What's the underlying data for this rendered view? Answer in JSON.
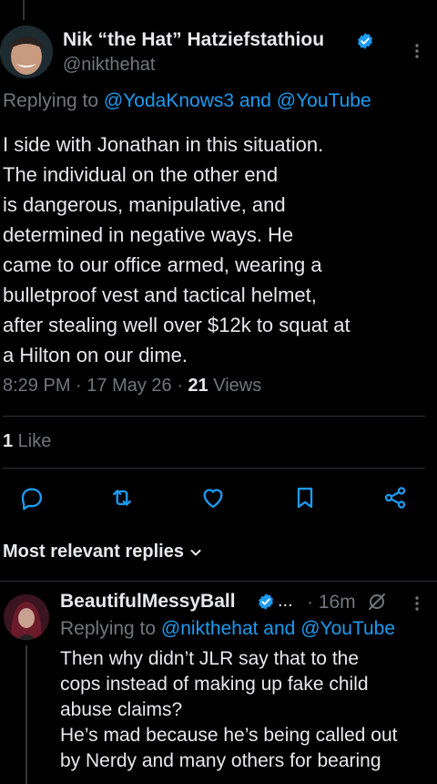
{
  "tweet": {
    "author_name": "Nik “the Hat” Hatziefstathiou",
    "handle": "@nikthehat",
    "replying_prefix": "Replying to ",
    "replying_to_1": "@YodaKnows3",
    "replying_and": " and ",
    "replying_to_2": "@YouTube",
    "text": "I side with Jonathan in this situation.\nThe individual on the other end\nis dangerous, manipulative, and\ndetermined in negative ways. He\ncame to our office armed, wearing a\nbulletproof vest and tactical helmet,\nafter stealing well over $12k to squat at\na Hilton on our dime.",
    "time": "8:29 PM",
    "date": "17 May 26",
    "sep": " · ",
    "views_count": "21",
    "views_label": " Views",
    "likes_count": "1",
    "likes_label": " Like"
  },
  "actions": {
    "reply_icon": "reply-icon",
    "retweet_icon": "retweet-icon",
    "like_icon": "heart-icon",
    "bookmark_icon": "bookmark-icon",
    "share_icon": "share-icon"
  },
  "replies_header": {
    "label": "Most relevant replies"
  },
  "reply": {
    "author_name": "BeautifulMessyBall",
    "ellipsis": "...",
    "time": "· 16m",
    "replying_prefix": "Replying to ",
    "replying_to_1": "@nikthehat",
    "replying_and": " and ",
    "replying_to_2": "@YouTube",
    "text": "Then why didn’t JLR say that to the\ncops  instead of making up fake child\nabuse claims?\nHe’s mad because he’s being called out\nby Nerdy and many others for bearing"
  },
  "colors": {
    "background": "#000000",
    "text": "#e7e9ea",
    "secondary": "#71767b",
    "link": "#1d9bf0",
    "verified": "#1d9bf0"
  }
}
